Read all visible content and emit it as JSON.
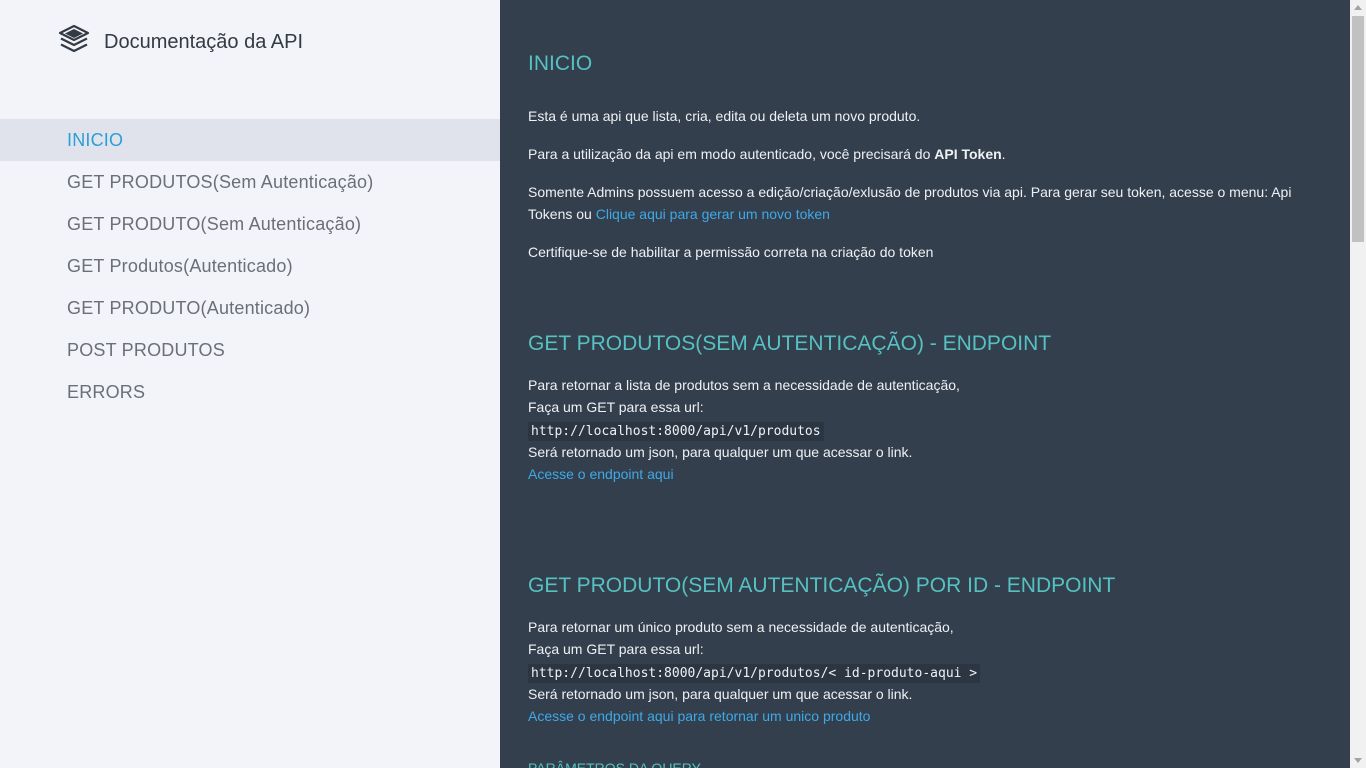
{
  "sidebar": {
    "logo_icon": "layers-icon",
    "title": "Documentação da API",
    "items": [
      {
        "label": "INICIO",
        "active": true
      },
      {
        "label": "GET PRODUTOS(Sem Autenticação)"
      },
      {
        "label": "GET PRODUTO(Sem Autenticação)"
      },
      {
        "label": "GET Produtos(Autenticado)"
      },
      {
        "label": "GET PRODUTO(Autenticado)"
      },
      {
        "label": "POST PRODUTOS"
      },
      {
        "label": "ERRORS"
      }
    ]
  },
  "main": {
    "inicio": {
      "title": "INICIO",
      "p1": "Esta é uma api que lista, cria, edita ou deleta um novo produto.",
      "p2_prefix": "Para a utilização da api em modo autenticado, você precisará do ",
      "p2_bold": "API Token",
      "p2_suffix": ".",
      "p3_line1": "Somente Admins possuem acesso a edição/criação/exlusão de produtos via api. Para gerar seu token, acesse o menu: Api",
      "p3_line2_prefix": "Tokens ou ",
      "p3_link": "Clique aqui para gerar um novo token",
      "p4": "Certifique-se de habilitar a permissão correta na criação do token"
    },
    "get_produtos": {
      "title": "GET PRODUTOS(SEM AUTENTICAÇÃO) - ENDPOINT",
      "line1": "Para retornar a lista de produtos sem a necessidade de autenticação,",
      "line2": "Faça um GET para essa url:",
      "url": "http://localhost:8000/api/v1/produtos",
      "line3": "Será retornado um json, para qualquer um que acessar o link.",
      "link": "Acesse o endpoint aqui"
    },
    "get_produto": {
      "title": "GET PRODUTO(SEM AUTENTICAÇÃO) POR ID - ENDPOINT",
      "line1": "Para retornar um único produto sem a necessidade de autenticação,",
      "line2": "Faça um GET para essa url:",
      "url": "http://localhost:8000/api/v1/produtos/< id-produto-aqui >",
      "line3": "Será retornado um json, para qualquer um que acessar o link.",
      "link": "Acesse o endpoint aqui para retornar um unico produto",
      "next_heading": "PARÂMETROS DA QUERY"
    }
  },
  "colors": {
    "sidebar_bg": "#f2f4f9",
    "main_bg": "#333f4c",
    "heading": "#56c1c3",
    "link": "#3fa9e8",
    "active_nav": "#2b9fd6"
  }
}
